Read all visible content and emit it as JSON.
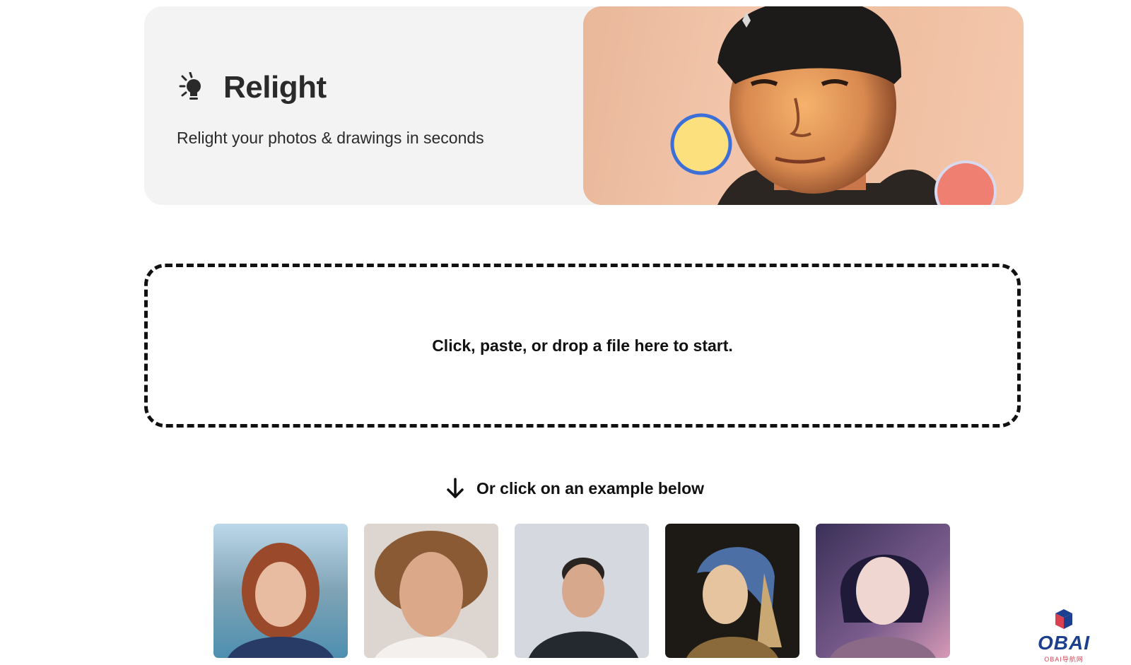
{
  "hero": {
    "title": "Relight",
    "subtitle": "Relight your photos & drawings in seconds",
    "icon": "lightbulb-icon",
    "image": "portrait-with-light-controls"
  },
  "dropzone": {
    "text": "Click, paste, or drop a file here to start."
  },
  "examples": {
    "hint": "Or click on an example below",
    "icon": "arrow-down-icon",
    "items": [
      {
        "name": "example-redhead-woman"
      },
      {
        "name": "example-curly-hair-man"
      },
      {
        "name": "example-man-dark-shirt"
      },
      {
        "name": "example-girl-pearl-earring"
      },
      {
        "name": "example-anime-girl"
      }
    ]
  },
  "watermark": {
    "text": "OBAI",
    "subtext": "OBAI导航网"
  },
  "colors": {
    "card_bg": "#f3f3f3",
    "light_yellow": "#fce07e",
    "light_ring": "#3d6fd9",
    "light_red": "#ef7f70"
  }
}
